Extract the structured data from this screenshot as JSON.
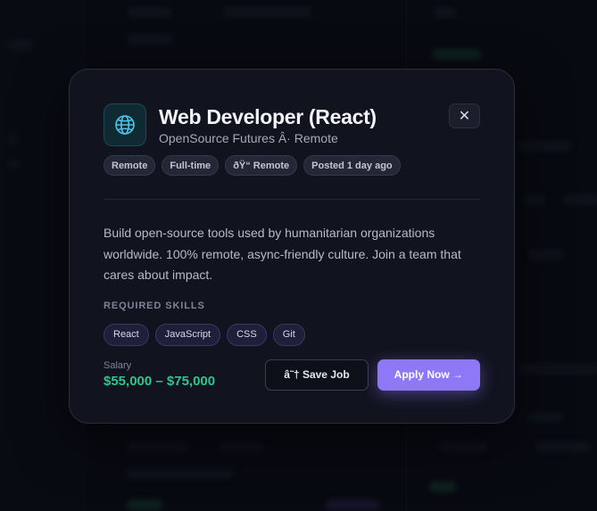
{
  "job": {
    "title": "Web Developer (React)",
    "company": "OpenSource Futures Â· Remote",
    "logo_icon": "globe-icon",
    "tags": [
      "Remote",
      "Full-time",
      "ðŸ“ Remote",
      "Posted 1 day ago"
    ],
    "description": "Build open-source tools used by humanitarian organizations worldwide. 100% remote, async-friendly culture. Join a team that cares about impact.",
    "skills_heading": "REQUIRED SKILLS",
    "skills": [
      "React",
      "JavaScript",
      "CSS",
      "Git"
    ],
    "salary_label": "Salary",
    "salary_value": "$55,000 – $75,000"
  },
  "actions": {
    "close_label": "✕",
    "save_label": "â˜† Save Job",
    "apply_label": "Apply Now →"
  },
  "colors": {
    "accent": "#8e78f6",
    "salary": "#2ec58e",
    "modal_bg": "#11131f"
  }
}
